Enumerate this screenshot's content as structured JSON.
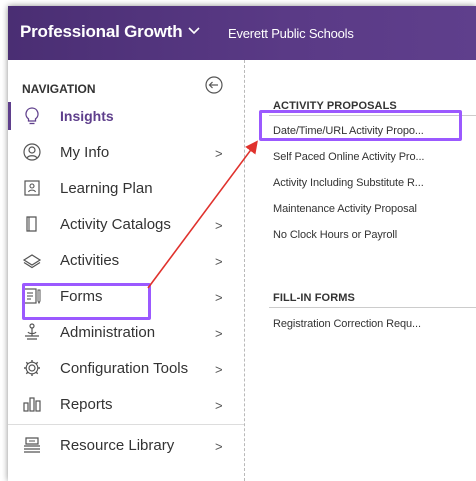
{
  "app": {
    "title": "Professional Growth",
    "org": "Everett Public Schools"
  },
  "nav": {
    "header": "NAVIGATION",
    "items": [
      {
        "label": "Insights",
        "icon": "lightbulb-icon",
        "active": true,
        "has_arrow": false
      },
      {
        "label": "My Info",
        "icon": "user-circle-icon",
        "has_arrow": true
      },
      {
        "label": "Learning Plan",
        "icon": "learning-plan-icon",
        "has_arrow": false
      },
      {
        "label": "Activity Catalogs",
        "icon": "catalog-icon",
        "has_arrow": true
      },
      {
        "label": "Activities",
        "icon": "activities-icon",
        "has_arrow": true
      },
      {
        "label": "Forms",
        "icon": "forms-icon",
        "has_arrow": true
      },
      {
        "label": "Administration",
        "icon": "administration-icon",
        "has_arrow": true
      },
      {
        "label": "Configuration Tools",
        "icon": "gear-icon",
        "has_arrow": true
      },
      {
        "label": "Reports",
        "icon": "reports-icon",
        "has_arrow": true
      },
      {
        "label": "Resource Library",
        "icon": "library-icon",
        "has_arrow": true
      }
    ],
    "arrow_glyph": ">"
  },
  "panel": {
    "sections": [
      {
        "title": "ACTIVITY PROPOSALS",
        "links": [
          "Date/Time/URL Activity Propo...",
          "Self Paced Online Activity Pro...",
          "Activity Including Substitute R...",
          "Maintenance Activity Proposal",
          "No Clock Hours or Payroll"
        ]
      },
      {
        "title": "FILL-IN FORMS",
        "links": [
          "Registration Correction Requ..."
        ]
      }
    ]
  },
  "colors": {
    "brand": "#5f3f8c",
    "highlight": "#9b59ff",
    "annotation_arrow": "#e0322d"
  }
}
